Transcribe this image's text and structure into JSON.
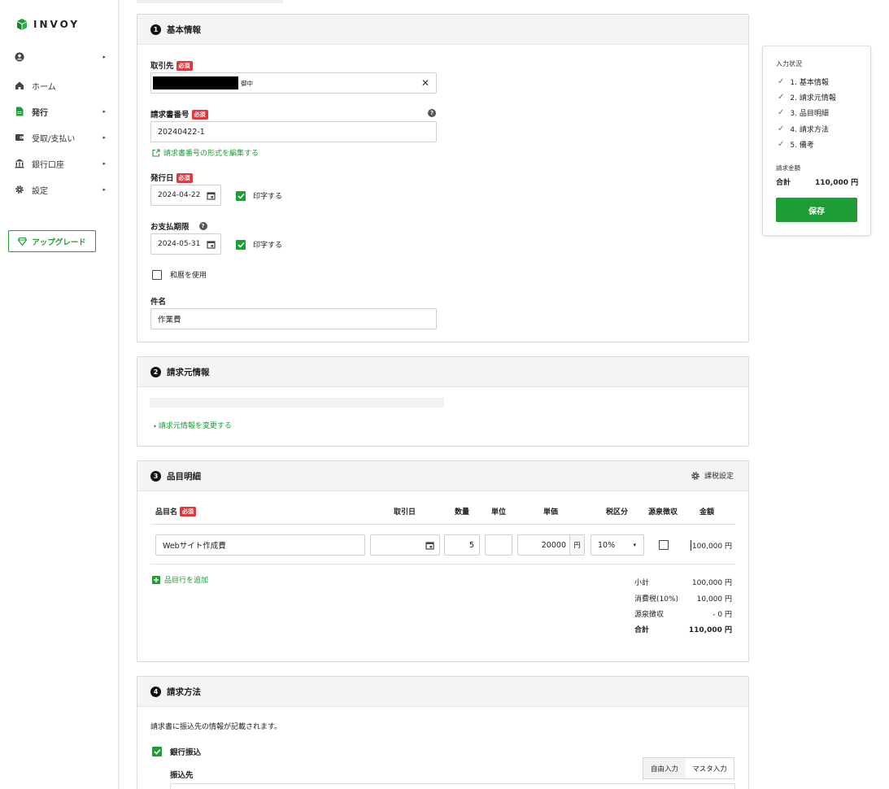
{
  "app": {
    "logo_text": "INVOY"
  },
  "sidebar": {
    "items": [
      {
        "label": "",
        "icon": "user-circle-icon"
      },
      {
        "label": "ホーム",
        "icon": "home-icon"
      },
      {
        "label": "発行",
        "icon": "document-icon"
      },
      {
        "label": "受取/支払い",
        "icon": "wallet-icon"
      },
      {
        "label": "銀行口座",
        "icon": "bank-icon"
      },
      {
        "label": "設定",
        "icon": "gear-icon"
      }
    ],
    "upgrade_label": "アップグレード"
  },
  "section1": {
    "number": "1",
    "title": "基本情報",
    "required_badge": "必須",
    "client_label": "取引先",
    "client_suffix": "御中",
    "invoice_no_label": "請求書番号",
    "invoice_no_value": "20240422-1",
    "edit_format_link": "請求書番号の形式を編集する",
    "issue_date_label": "発行日",
    "issue_date_value": "2024-04-22",
    "print_label": "印字する",
    "due_date_label": "お支払期限",
    "due_date_value": "2024-05-31",
    "wareki_label": "和暦を使用",
    "subject_label": "件名",
    "subject_value": "作業費"
  },
  "section2": {
    "number": "2",
    "title": "請求元情報",
    "change_link": "請求元情報を変更する"
  },
  "section3": {
    "number": "3",
    "title": "品目明細",
    "tax_settings": "課税設定",
    "columns": [
      "品目名",
      "取引日",
      "数量",
      "単位",
      "単価",
      "税区分",
      "源泉徴収",
      "金額"
    ],
    "row": {
      "name": "Webサイト作成費",
      "date": "",
      "qty": "5",
      "unit": "",
      "price": "20000",
      "yen": "円",
      "tax": "10%",
      "amount": "100,000 円"
    },
    "add_row": "品目行を追加",
    "summary": [
      {
        "label": "小計",
        "value": "100,000 円"
      },
      {
        "label": "消費税(10%)",
        "value": "10,000 円"
      },
      {
        "label": "源泉徴収",
        "value": "- 0 円"
      },
      {
        "label": "合計",
        "value": "110,000 円"
      }
    ]
  },
  "section4": {
    "number": "4",
    "title": "請求方法",
    "desc": "請求書に振込先の情報が記載されます。",
    "bank_transfer": "銀行振込",
    "dest_label": "振込先",
    "tab_free": "自由入力",
    "tab_master": "マスタ入力"
  },
  "status_panel": {
    "title": "入力状況",
    "steps": [
      "1. 基本情報",
      "2. 請求元情報",
      "3. 品目明細",
      "4. 請求方法",
      "5. 備考"
    ],
    "amount_label": "請求金額",
    "total_label": "合計",
    "total_value": "110,000 円",
    "save_label": "保存"
  },
  "colors": {
    "accent": "#1e9c35",
    "required": "#e0383e"
  }
}
